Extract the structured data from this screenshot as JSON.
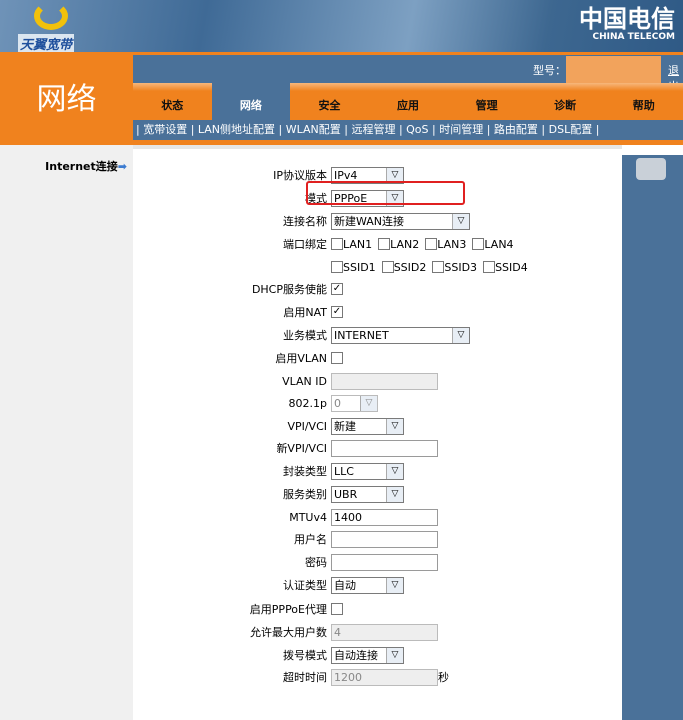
{
  "header": {
    "brand_left": "天翼宽带",
    "brand_right_cn": "中国电信",
    "brand_right_en": "CHINA TELECOM"
  },
  "section_title": "网络",
  "model_label": "型号：",
  "logout": "退出",
  "tabs": [
    {
      "label": "状态"
    },
    {
      "label": "网络",
      "active": true
    },
    {
      "label": "安全"
    },
    {
      "label": "应用"
    },
    {
      "label": "管理"
    },
    {
      "label": "诊断"
    },
    {
      "label": "帮助"
    }
  ],
  "subnav": "| 宽带设置 | LAN侧地址配置 | WLAN配置 | 远程管理 | QoS | 时间管理 | 路由配置 | DSL配置 |",
  "sidebar": {
    "item": "Internet连接",
    "arrow": "➡"
  },
  "form": [
    {
      "label": "IP协议版本",
      "type": "select",
      "value": "IPv4",
      "w": 73
    },
    {
      "label": "模式",
      "type": "select",
      "value": "PPPoE",
      "w": 73
    },
    {
      "label": "连接名称",
      "type": "select",
      "value": "新建WAN连接",
      "w": 139
    },
    {
      "label": "端口绑定",
      "type": "checks",
      "options": [
        "LAN1",
        "LAN2",
        "LAN3",
        "LAN4"
      ]
    },
    {
      "label": "",
      "type": "checks",
      "options": [
        "SSID1",
        "SSID2",
        "SSID3",
        "SSID4"
      ]
    },
    {
      "label": "DHCP服务使能",
      "type": "checkbox",
      "checked": true
    },
    {
      "label": "启用NAT",
      "type": "checkbox",
      "checked": true
    },
    {
      "label": "业务模式",
      "type": "select",
      "value": "INTERNET",
      "w": 139
    },
    {
      "label": "启用VLAN",
      "type": "checkbox",
      "checked": false
    },
    {
      "label": "VLAN ID",
      "type": "input",
      "value": "",
      "disabled": true
    },
    {
      "label": "802.1p",
      "type": "select",
      "value": "0",
      "w": 47,
      "disabled": true
    },
    {
      "label": "VPI/VCI",
      "type": "select",
      "value": "新建",
      "w": 73
    },
    {
      "label": "新VPI/VCI",
      "type": "input",
      "value": ""
    },
    {
      "label": "封装类型",
      "type": "select",
      "value": "LLC",
      "w": 73
    },
    {
      "label": "服务类别",
      "type": "select",
      "value": "UBR",
      "w": 73
    },
    {
      "label": "MTUv4",
      "type": "input",
      "value": "1400"
    },
    {
      "label": "用户名",
      "type": "input",
      "value": ""
    },
    {
      "label": "密码",
      "type": "input",
      "value": ""
    },
    {
      "label": "认证类型",
      "type": "select",
      "value": "自动",
      "w": 73
    },
    {
      "label": "启用PPPoE代理",
      "type": "checkbox",
      "checked": false
    },
    {
      "label": "允许最大用户数",
      "type": "input",
      "value": "4",
      "disabled": true
    },
    {
      "label": "拨号模式",
      "type": "select",
      "value": "自动连接",
      "w": 73
    },
    {
      "label": "超时时间",
      "type": "input",
      "value": "1200",
      "disabled": true,
      "suffix": "秒"
    }
  ]
}
